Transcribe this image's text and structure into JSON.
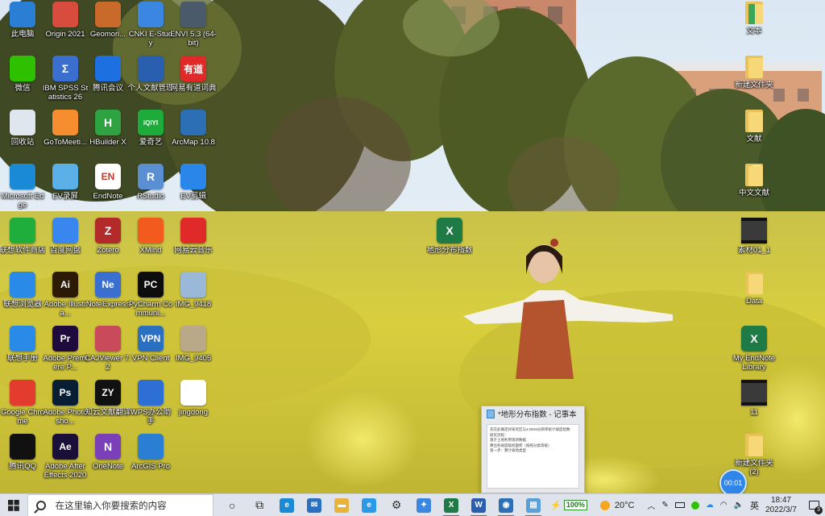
{
  "desktop": {
    "col1": [
      {
        "label": "此电脑",
        "icon": "computer-icon",
        "text": "",
        "color": "#2a7fd4"
      },
      {
        "label": "微信",
        "icon": "wechat-icon",
        "text": "",
        "color": "#2dc100"
      },
      {
        "label": "回收站",
        "icon": "recycle-bin-icon",
        "text": "",
        "color": "#dfe6ee"
      },
      {
        "label": "Microsoft Edge",
        "icon": "edge-icon",
        "text": "",
        "color": "#1b8ad6"
      },
      {
        "label": "联想软件商店",
        "icon": "store-icon",
        "text": "",
        "color": "#1fae3c"
      },
      {
        "label": "联想浏览器",
        "icon": "browser-icon",
        "text": "",
        "color": "#2a8ae8"
      },
      {
        "label": "联想手册",
        "icon": "manual-icon",
        "text": "",
        "color": "#2a8ae8"
      },
      {
        "label": "Google Chrome",
        "icon": "chrome-icon",
        "text": "",
        "color": "#e33b2e"
      },
      {
        "label": "腾讯QQ",
        "icon": "qq-icon",
        "text": "",
        "color": "#111111"
      }
    ],
    "col2": [
      {
        "label": "Origin 2021",
        "icon": "origin-icon",
        "text": "",
        "color": "#d84c3e"
      },
      {
        "label": "IBM SPSS Statistics 26",
        "icon": "spss-icon",
        "text": "Σ",
        "color": "#3b6fcf"
      },
      {
        "label": "GoToMeeti...",
        "icon": "gotomeeting-icon",
        "text": "",
        "color": "#f68d2e"
      },
      {
        "label": "EV录屏",
        "icon": "ev-recorder-icon",
        "text": "",
        "color": "#5cb0e8"
      },
      {
        "label": "百度网盘",
        "icon": "baidu-netdisk-icon",
        "text": "",
        "color": "#3a86f0"
      },
      {
        "label": "Adobe Illustra...",
        "icon": "illustrator-icon",
        "text": "Ai",
        "color": "#2d1a05"
      },
      {
        "label": "Adobe Premiere P...",
        "icon": "premiere-icon",
        "text": "Pr",
        "color": "#1e0a3c"
      },
      {
        "label": "Adobe Photosho...",
        "icon": "photoshop-icon",
        "text": "Ps",
        "color": "#071e33"
      },
      {
        "label": "Adobe After Effects 2020",
        "icon": "aftereffects-icon",
        "text": "Ae",
        "color": "#1a0f38"
      }
    ],
    "col3": [
      {
        "label": "Geomori...",
        "icon": "geo-icon",
        "text": "",
        "color": "#c96a2a"
      },
      {
        "label": "腾讯会议",
        "icon": "tencent-meeting-icon",
        "text": "",
        "color": "#1e6fe0"
      },
      {
        "label": "HBuilder X",
        "icon": "hbuilder-icon",
        "text": "H",
        "color": "#2fa341"
      },
      {
        "label": "EndNote",
        "icon": "endnote-icon",
        "text": "EN",
        "color": "#ffffff"
      },
      {
        "label": "Zotero",
        "icon": "zotero-icon",
        "text": "Z",
        "color": "#b22a2a"
      },
      {
        "label": "NoteExpress",
        "icon": "noteexpress-icon",
        "text": "Ne",
        "color": "#3b6fcf"
      },
      {
        "label": "CAJViewer 7.2",
        "icon": "cajviewer-icon",
        "text": "",
        "color": "#c94a5a"
      },
      {
        "label": "知云文献翻译",
        "icon": "zhiyun-icon",
        "text": "ZY",
        "color": "#111111"
      },
      {
        "label": "OneNote",
        "icon": "onenote-icon",
        "text": "N",
        "color": "#7b3fb8"
      }
    ],
    "col4": [
      {
        "label": "CNKI E-Study",
        "icon": "cnki-icon",
        "text": "",
        "color": "#3a86e0"
      },
      {
        "label": "个人文献管理",
        "icon": "literature-icon",
        "text": "",
        "color": "#2a5fb0"
      },
      {
        "label": "爱奇艺",
        "icon": "iqiyi-icon",
        "text": "iQIYI",
        "color": "#1faa3c"
      },
      {
        "label": "RStudio",
        "icon": "rstudio-icon",
        "text": "R",
        "color": "#5b8fd4"
      },
      {
        "label": "XMind",
        "icon": "xmind-icon",
        "text": "",
        "color": "#f25a1e"
      },
      {
        "label": "PyCharm Communi...",
        "icon": "pycharm-icon",
        "text": "PC",
        "color": "#0d0d0d"
      },
      {
        "label": "VPN Client",
        "icon": "vpn-icon",
        "text": "VPN",
        "color": "#2a6fc0"
      },
      {
        "label": "WPS办公助手",
        "icon": "wps-icon",
        "text": "",
        "color": "#2e6fd6"
      },
      {
        "label": "ArcGIS Pro",
        "icon": "arcgis-icon",
        "text": "",
        "color": "#2a7fd4"
      }
    ],
    "col5": [
      {
        "label": "ENVI 5.3 (64-bit)",
        "icon": "envi-icon",
        "text": "",
        "color": "#4a5a6a"
      },
      {
        "label": "网易有道词典",
        "icon": "youdao-icon",
        "text": "有道",
        "color": "#e02a2a"
      },
      {
        "label": "ArcMap 10.8",
        "icon": "arcmap-icon",
        "text": "",
        "color": "#2c6fb5"
      },
      {
        "label": "EV剪辑",
        "icon": "ev-editor-icon",
        "text": "",
        "color": "#2a86e8"
      },
      {
        "label": "网易云音乐",
        "icon": "netease-music-icon",
        "text": "",
        "color": "#e02a2a"
      },
      {
        "label": "IMG_9418",
        "icon": "image-file-icon",
        "text": "",
        "color": "#9ab9d9"
      },
      {
        "label": "IMG_9405",
        "icon": "image-file-icon",
        "text": "",
        "color": "#b9a989"
      },
      {
        "label": "jingdong",
        "icon": "text-file-icon",
        "text": "",
        "color": "#ffffff"
      }
    ],
    "right_col": [
      {
        "label": "文本",
        "icon": "folder-icon",
        "kind": "folder"
      },
      {
        "label": "新建文件夹",
        "icon": "folder-icon",
        "kind": "folder"
      },
      {
        "label": "文献",
        "icon": "folder-icon",
        "kind": "folder"
      },
      {
        "label": "中文文献",
        "icon": "folder-icon",
        "kind": "folder-doc"
      },
      {
        "label": "素材01_1",
        "icon": "video-file-icon",
        "kind": "video"
      },
      {
        "label": "Data",
        "icon": "folder-icon",
        "kind": "folder"
      },
      {
        "label": "My EndNote Library",
        "icon": "excel-file-icon",
        "kind": "excel"
      },
      {
        "label": "11",
        "icon": "video-file-icon",
        "kind": "video"
      },
      {
        "label": "新建文件夹 (2)",
        "icon": "folder-icon",
        "kind": "folder"
      }
    ],
    "floating": {
      "label": "地形分布指数",
      "icon": "excel-file-icon"
    }
  },
  "taskbar": {
    "search_placeholder": "在这里输入你要搜索的内容",
    "apps": [
      {
        "name": "cortana-button",
        "icon": "cortana-icon",
        "glyph": "○",
        "color": "#222222",
        "active": false
      },
      {
        "name": "task-view-button",
        "icon": "task-view-icon",
        "glyph": "⧉",
        "color": "#222222",
        "active": false
      },
      {
        "name": "edge-taskbar-button",
        "icon": "edge-icon",
        "glyph": "e",
        "color": "#1b8ad6",
        "active": false
      },
      {
        "name": "mail-taskbar-button",
        "icon": "mail-icon",
        "glyph": "✉",
        "color": "#2a6fc0",
        "active": false
      },
      {
        "name": "explorer-taskbar-button",
        "icon": "folder-icon",
        "glyph": "▬",
        "color": "#e9b23a",
        "active": false
      },
      {
        "name": "browser-taskbar-button",
        "icon": "browser-icon",
        "glyph": "e",
        "color": "#2a9ae8",
        "active": false
      },
      {
        "name": "settings-taskbar-button",
        "icon": "gear-icon",
        "glyph": "⚙",
        "color": "#333333",
        "active": false
      },
      {
        "name": "cnki-taskbar-button",
        "icon": "cnki-icon",
        "glyph": "✦",
        "color": "#3a86e0",
        "active": false
      },
      {
        "name": "excel-taskbar-button",
        "icon": "excel-icon",
        "glyph": "X",
        "color": "#1e7b45",
        "active": true
      },
      {
        "name": "word-taskbar-button",
        "icon": "word-icon",
        "glyph": "W",
        "color": "#2a5fb0",
        "active": true
      },
      {
        "name": "arcmap-taskbar-button",
        "icon": "arcmap-icon",
        "glyph": "◉",
        "color": "#2c6fb5",
        "active": true
      },
      {
        "name": "notepad-taskbar-button",
        "icon": "notepad-icon",
        "glyph": "▤",
        "color": "#5aa0d8",
        "active": true
      }
    ]
  },
  "tray": {
    "battery": "100%",
    "weather": "20°C",
    "ime": "英",
    "time": "18:47",
    "date": "2022/3/7",
    "notifications": "3"
  },
  "notepad_thumb": {
    "title": "*地形分布指数 - 记事本",
    "lines": [
      "先在此确定好研究区与3·DEM分辨率统计坡度指数",
      "研究流程：",
      "基于土地利用现状数据",
      "算出各坡度级别面积（按照分类等级）",
      "第一步：算计坡地类型"
    ]
  },
  "timer": "00:01",
  "colors": {
    "taskbar_bg": "#dfe4ec",
    "accent": "#3a7bd5",
    "sky": "#cfe0ef",
    "flowers": "#d9d23a"
  }
}
